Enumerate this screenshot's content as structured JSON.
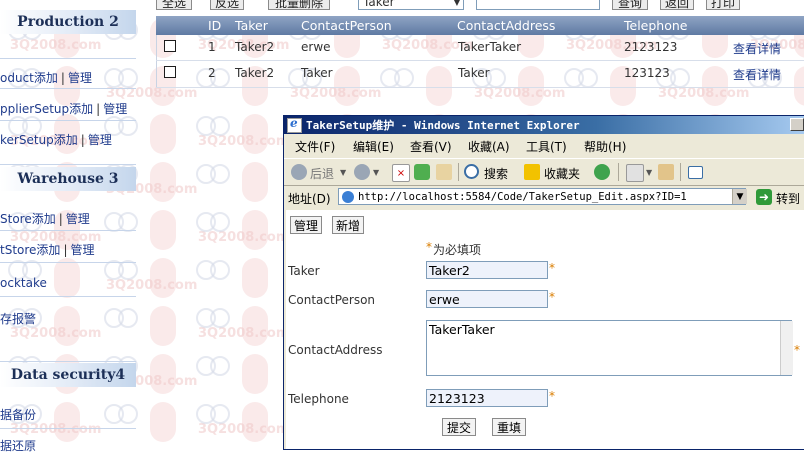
{
  "sidebar": {
    "sections": [
      {
        "title": "Production 2"
      },
      {
        "title": "Warehouse 3"
      },
      {
        "title": "Data security4"
      }
    ],
    "items": [
      {
        "name": "oduct",
        "add": "添加",
        "sep": "|",
        "manage": "管理"
      },
      {
        "name": "pplierSetup",
        "add": "添加",
        "sep": "|",
        "manage": "管理"
      },
      {
        "name": "kerSetup",
        "add": "添加",
        "sep": "|",
        "manage": "管理"
      },
      {
        "name": "Store",
        "add": "添加",
        "sep": "|",
        "manage": "管理"
      },
      {
        "name": "tStore",
        "add": "添加",
        "sep": "|",
        "manage": "管理"
      },
      {
        "name": "ocktake"
      },
      {
        "name": "存报警"
      },
      {
        "name": "据备份"
      },
      {
        "name": "据还原"
      }
    ]
  },
  "toolbar": {
    "select_all": "全选",
    "invert": "反选",
    "batch_delete": "批量删除",
    "field_select": "Taker",
    "query": "查询",
    "back": "返回",
    "print": "打印"
  },
  "grid": {
    "columns": [
      "ID",
      "Taker",
      "ContactPerson",
      "ContactAddress",
      "Telephone"
    ],
    "rows": [
      {
        "id": "1",
        "taker": "Taker2",
        "contact_person": "erwe",
        "contact_address": "TakerTaker",
        "telephone": "2123123",
        "details": "查看详情"
      },
      {
        "id": "2",
        "taker": "Taker2",
        "contact_person": "Taker",
        "contact_address": "Taker",
        "telephone": "123123",
        "details": "查看详情"
      }
    ]
  },
  "ie": {
    "title": "TakerSetup维护 - Windows Internet Explorer",
    "menu": [
      "文件(F)",
      "编辑(E)",
      "查看(V)",
      "收藏(A)",
      "工具(T)",
      "帮助(H)"
    ],
    "toolbar": {
      "back": "后退",
      "search": "搜索",
      "favorites": "收藏夹"
    },
    "address_label": "地址(D)",
    "address_url": "http://localhost:5584/Code/TakerSetup_Edit.aspx?ID=1",
    "go_label": "转到",
    "page": {
      "manage_button": "管理",
      "add_button": "新增",
      "required_star": "*",
      "required_note": "为必填项",
      "fields": [
        {
          "label": "Taker",
          "value": "Taker2"
        },
        {
          "label": "ContactPerson",
          "value": "erwe"
        },
        {
          "label": "ContactAddress",
          "value": "TakerTaker"
        },
        {
          "label": "Telephone",
          "value": "2123123"
        }
      ],
      "submit_button": "提交",
      "reset_button": "重填"
    }
  },
  "watermark_text": "3Q2008.com",
  "colors": {
    "header_gradient_dark": "#0a246a",
    "link": "#1f3b8c",
    "required": "#d97d00"
  }
}
